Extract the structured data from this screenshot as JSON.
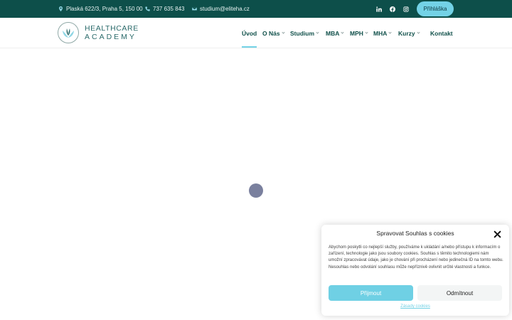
{
  "topbar": {
    "address": "Plaská 622/3, Praha 5, 150 00",
    "phone": "737 635 843",
    "email": "studium@eliteha.cz",
    "apply_label": "Přihláška"
  },
  "logo": {
    "line1": "HEALTHCARE",
    "line2": "ACADEMY"
  },
  "nav": {
    "items": [
      {
        "label": "Úvod"
      },
      {
        "label": "O Nás"
      },
      {
        "label": "Studium"
      },
      {
        "label": "MBA"
      },
      {
        "label": "MPH"
      },
      {
        "label": "MHA"
      },
      {
        "label": "Kurzy"
      },
      {
        "label": "Kontakt"
      }
    ]
  },
  "cookie": {
    "title": "Spravovat Souhlas s cookies",
    "text": "Abychom poskytli co nejlepší služby, používáme k ukládání a/nebo přístupu k informacím o zařízení, technologie jako jsou soubory cookies. Souhlas s těmito technologiemi nám umožní zpracovávat údaje, jako je chování při procházení nebo jedinečná ID na tomto webu. Nesouhlas nebo odvolání souhlasu může nepříznivě ovlivnit určité vlastnosti a funkce.",
    "accept_label": "Přijmout",
    "deny_label": "Odmítnout",
    "policy_link": "Zásady cookies"
  },
  "colors": {
    "topbar_bg": "#0d4f4a",
    "accent": "#73d2e6",
    "nav_text": "#0f4f49",
    "loader": "#7a809e"
  }
}
